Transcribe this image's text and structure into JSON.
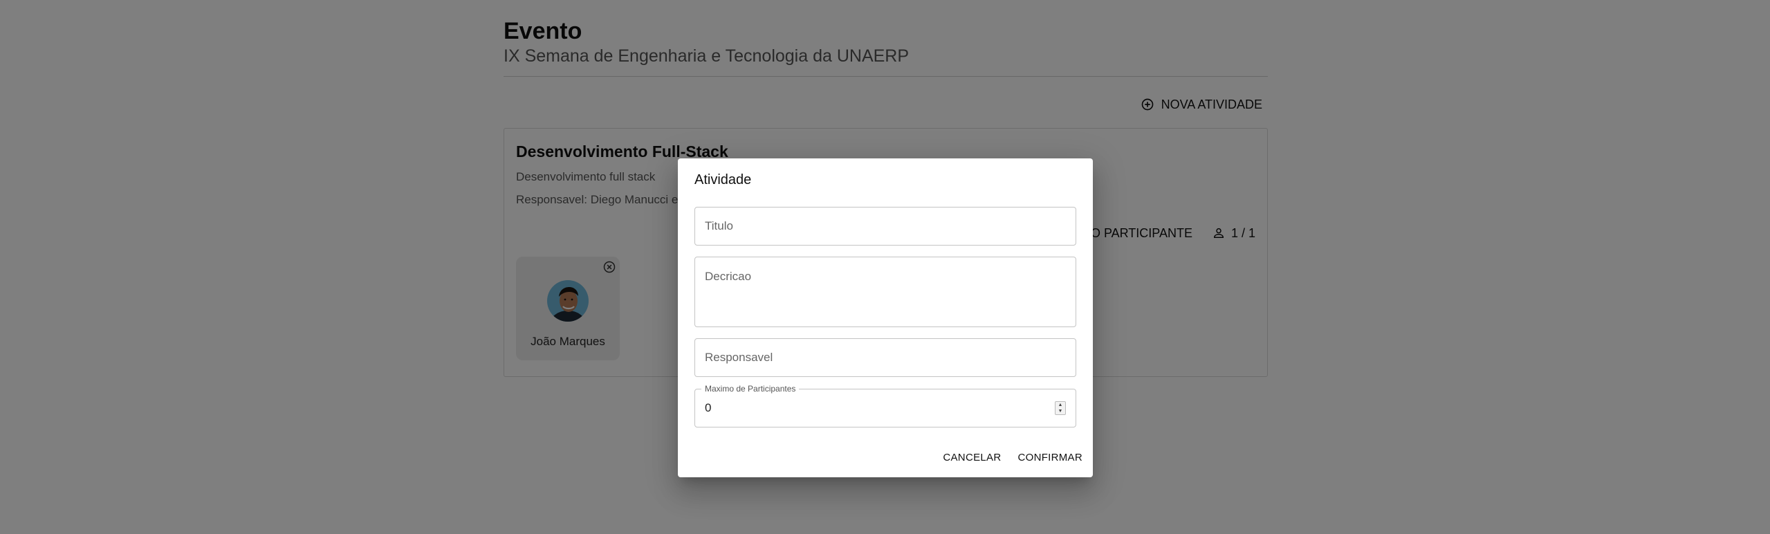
{
  "event": {
    "label": "Evento",
    "name": "IX Semana de Engenharia e Tecnologia da UNAERP"
  },
  "toolbar": {
    "new_activity_label": "NOVA ATIVIDADE",
    "new_activity_icon": "add-circle-icon"
  },
  "activity_card": {
    "title": "Desenvolvimento Full-Stack",
    "description": "Desenvolvimento full stack",
    "responsible": "Responsavel: Diego Manucci e J",
    "new_participant_label": "VO PARTICIPANTE",
    "participants_count": "1 / 1",
    "participants_icon": "person-icon",
    "participants": [
      {
        "name": "João Marques",
        "remove_icon": "close-circle-icon"
      }
    ]
  },
  "dialog": {
    "title": "Atividade",
    "fields": {
      "title_placeholder": "Titulo",
      "description_placeholder": "Decricao",
      "responsible_placeholder": "Responsavel",
      "max_participants_label": "Maximo de Participantes",
      "max_participants_value": "0"
    },
    "cancel_label": "CANCELAR",
    "confirm_label": "CONFIRMAR"
  },
  "colors": {
    "backdrop": "#000000",
    "text": "#111111",
    "muted": "#555555",
    "border": "#c4c4c4"
  }
}
